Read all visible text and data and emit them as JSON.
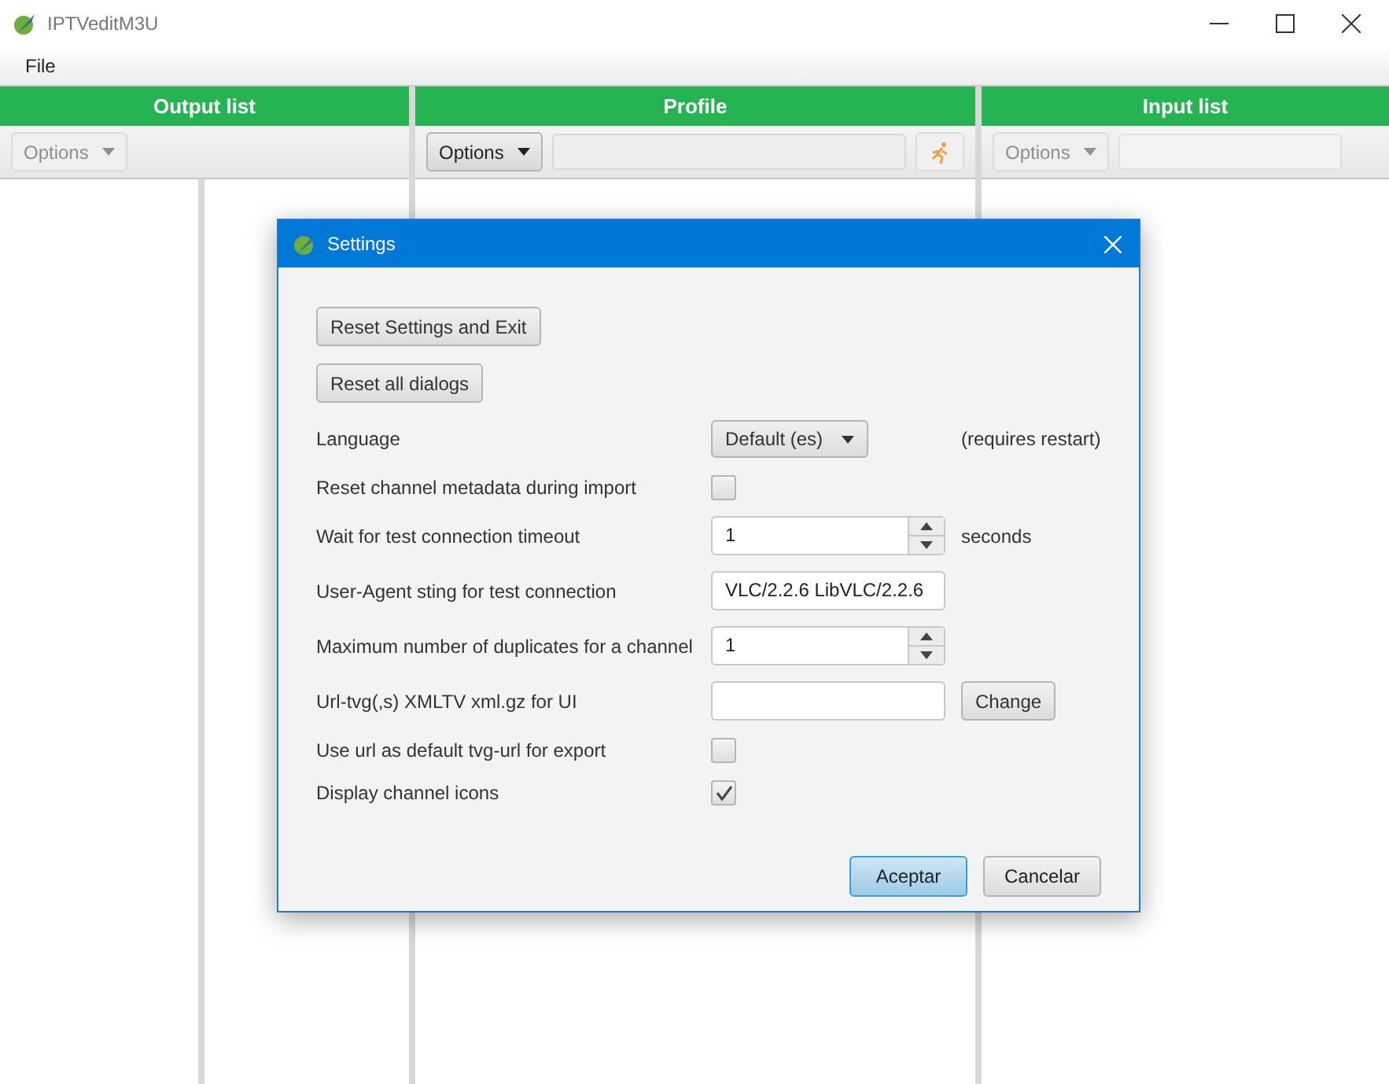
{
  "window": {
    "title": "IPTVeditM3U"
  },
  "menu": [
    "File"
  ],
  "panels": [
    {
      "title": "Output list",
      "options": {
        "label": "Options",
        "disabled": true
      },
      "split": true
    },
    {
      "title": "Profile",
      "options": {
        "label": "Options",
        "disabled": false
      },
      "search": {
        "disabled": false
      },
      "run_button": true
    },
    {
      "title": "Input list",
      "options": {
        "label": "Options",
        "disabled": true
      },
      "search": {
        "disabled": true
      }
    }
  ],
  "dialog": {
    "title": "Settings",
    "rows": [
      {
        "kind": "button",
        "label": "Reset Settings and Exit"
      },
      {
        "kind": "button",
        "label": "Reset all dialogs"
      },
      {
        "kind": "dropdown",
        "label": "Language",
        "value": "Default (es)",
        "note": "(requires restart)"
      },
      {
        "kind": "checkbox",
        "label": "Reset channel metadata during import",
        "checked": false
      },
      {
        "kind": "spinner",
        "label": "Wait for test connection timeout",
        "value": "1",
        "note": "seconds"
      },
      {
        "kind": "text",
        "label": "User-Agent sting for test connection",
        "value": "VLC/2.2.6 LibVLC/2.2.6"
      },
      {
        "kind": "spinner",
        "label": "Maximum number of duplicates for a channel",
        "value": "1"
      },
      {
        "kind": "text",
        "label": "Url-tvg(,s) XMLTV xml.gz for UI",
        "button": "Change"
      },
      {
        "kind": "checkbox",
        "label": "Use url as default tvg-url for export",
        "checked": false
      },
      {
        "kind": "checkbox",
        "label": "Display channel icons",
        "checked": true
      }
    ],
    "buttons": [
      {
        "label": "Aceptar",
        "default": true
      },
      {
        "label": "Cancelar",
        "default": false
      }
    ]
  }
}
